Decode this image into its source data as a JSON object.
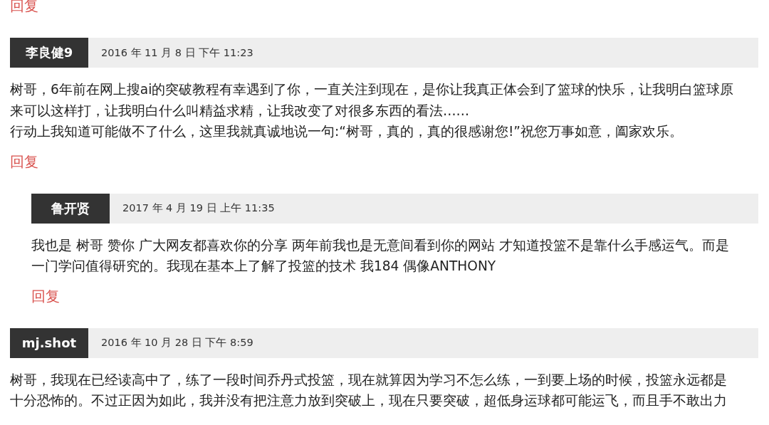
{
  "leading_reply_link": "回复",
  "comments": [
    {
      "author": "李良健9",
      "date": "2016 年 11 月 8 日 下午 11:23",
      "lines": [
        "树哥，6年前在网上搜ai的突破教程有幸遇到了你，一直关注到现在，是你让我真正体会到了篮球的快乐，让我明白篮球原",
        "来可以这样打，让我明白什么叫精益求精，让我改变了对很多东西的看法……",
        "行动上我知道可能做不了什么，这里我就真诚地说一句:“树哥，真的，真的很感谢您!”祝您万事如意，阖家欢乐。"
      ],
      "reply_link": "回复",
      "children": [
        {
          "author": "鲁开贤",
          "date": "2017 年 4 月 19 日 上午 11:35",
          "lines": [
            "我也是 树哥 赞你 广大网友都喜欢你的分享 两年前我也是无意间看到你的网站 才知道投篮不是靠什么手感运气。而是",
            "一门学问值得研究的。我现在基本上了解了投篮的技术 我184 偶像ANTHONY"
          ],
          "reply_link": "回复"
        }
      ]
    },
    {
      "author": "mj.shot",
      "date": "2016 年 10 月 28 日 下午 8:59",
      "lines": [
        "树哥，我现在已经读高中了，练了一段时间乔丹式投篮，现在就算因为学习不怎么练，一到要上场的时候，投篮永远都是",
        "十分恐怖的。不过正因为如此，我并没有把注意力放到突破上，现在只要突破，超低身运球都可能运飞，而且手不敢出力"
      ]
    }
  ]
}
